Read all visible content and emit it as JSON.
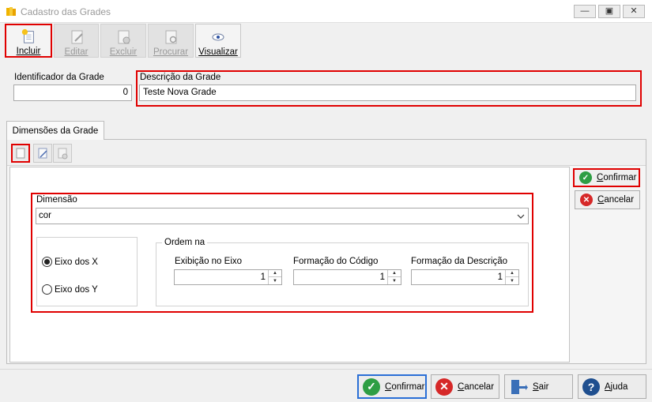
{
  "window": {
    "title": "Cadastro das Grades",
    "controls": [
      "minimize-icon",
      "restore-icon",
      "close-icon"
    ]
  },
  "toolbar": {
    "incluir": "Incluir",
    "editar": "Editar",
    "excluir": "Excluir",
    "procurar": "Procurar",
    "visualizar": "Visualizar"
  },
  "fields": {
    "identificador_label": "Identificador da Grade",
    "identificador_value": "0",
    "descricao_label": "Descrição da Grade",
    "descricao_value": "Teste Nova Grade"
  },
  "tabs": [
    {
      "label": "Dimensões da Grade"
    }
  ],
  "dimensao": {
    "label": "Dimensão",
    "selected": "cor",
    "eixo_x": "Eixo dos X",
    "eixo_y": "Eixo dos Y",
    "selected_eixo": "Eixo dos X",
    "ordem_label": "Ordem na",
    "exibicao_label": "Exibição no Eixo",
    "exibicao_value": "1",
    "codigo_label": "Formação do Código",
    "codigo_value": "1",
    "descricao_label": "Formação da Descrição",
    "descricao_value": "1"
  },
  "side_buttons": {
    "confirmar": "Confirmar",
    "cancelar": "Cancelar"
  },
  "bottom_buttons": {
    "confirmar": "Confirmar",
    "cancelar": "Cancelar",
    "sair": "Sair",
    "ajuda": "Ajuda"
  },
  "colors": {
    "highlight": "#e00000",
    "confirm": "#2e9e44",
    "cancel": "#d62828",
    "help": "#1f4f8f",
    "focus": "#2a6fd6"
  }
}
